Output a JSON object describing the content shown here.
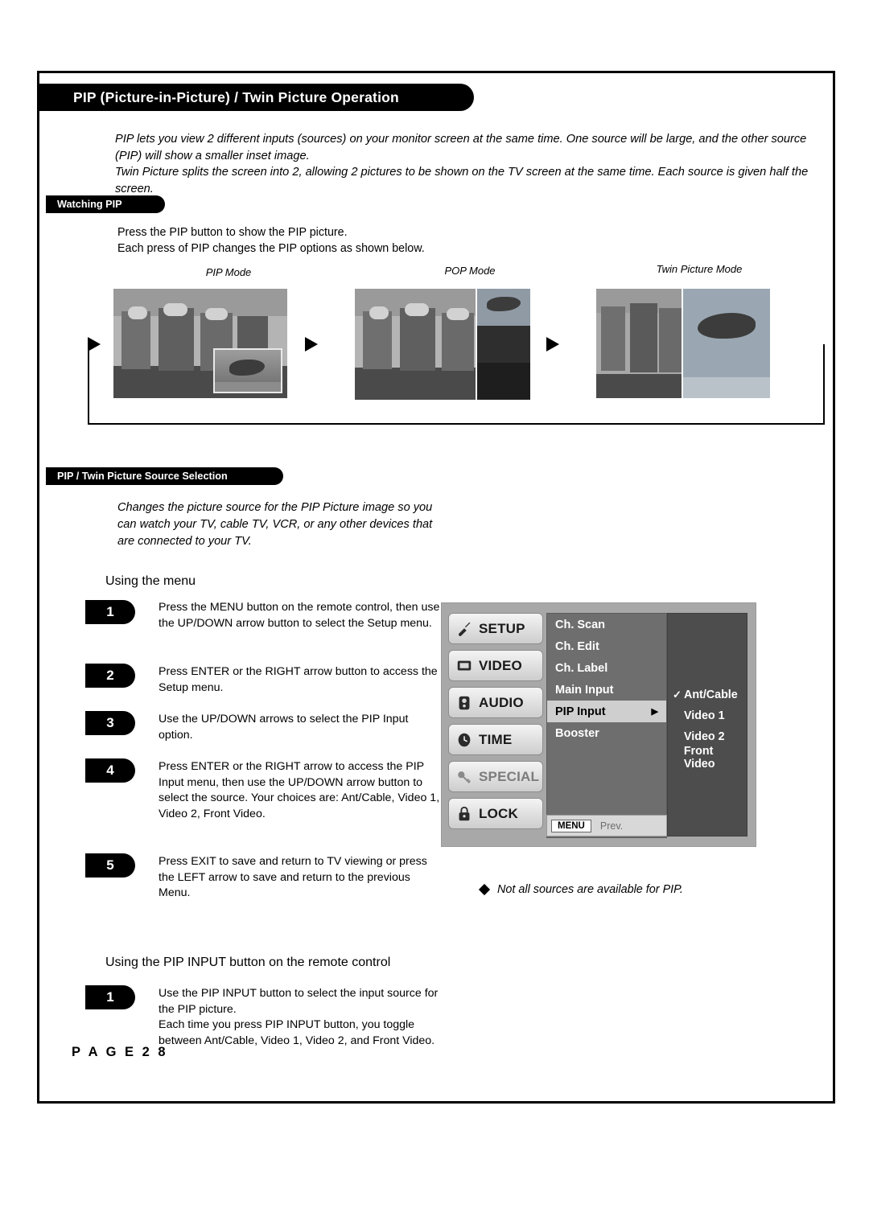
{
  "header": {
    "title": "PIP (Picture-in-Picture) / Twin Picture Operation"
  },
  "intro": {
    "line1": "PIP lets you view 2 different inputs (sources) on your monitor screen at the same time. One source will be large, and the other source (PIP) will show a smaller inset image.",
    "line2": "Twin Picture splits the screen into 2, allowing 2 pictures to be shown on the TV screen at the same time. Each source is given half the screen."
  },
  "watching_pip": {
    "tag": "Watching PIP",
    "line1": "Press the PIP button to show the PIP picture.",
    "line2": "Each press of PIP changes the PIP options as shown below.",
    "modes": [
      "PIP Mode",
      "POP Mode",
      "Twin Picture Mode"
    ]
  },
  "source_selection": {
    "tag": "PIP / Twin Picture Source Selection",
    "description": "Changes the picture source for the PIP Picture image so you can watch your TV, cable TV, VCR, or any other devices that are connected to your TV.",
    "subhead_menu": "Using the menu",
    "subhead_remote": "Using the PIP INPUT button on the remote control",
    "steps": [
      {
        "num": "1",
        "text": "Press the MENU button on the remote control, then use the UP/DOWN arrow button to select the Setup menu."
      },
      {
        "num": "2",
        "text": "Press ENTER or the RIGHT arrow button to access the Setup menu."
      },
      {
        "num": "3",
        "text": "Use the UP/DOWN arrows to select the PIP Input option."
      },
      {
        "num": "4",
        "text": "Press ENTER or the RIGHT arrow to access the PIP Input menu, then use the UP/DOWN arrow button to select the source. Your choices are: Ant/Cable, Video 1, Video 2, Front Video."
      },
      {
        "num": "5",
        "text": "Press EXIT to save and return to TV viewing or press the LEFT arrow to save and return to the previous Menu."
      }
    ],
    "remote_steps": [
      {
        "num": "1",
        "text": "Use the PIP INPUT button to select the input source for the PIP picture.\nEach time you press PIP INPUT button, you toggle between Ant/Cable, Video 1, Video 2, and Front Video."
      }
    ],
    "note": "Not all sources are available for PIP."
  },
  "osd": {
    "menus": [
      {
        "label": "SETUP",
        "icon": "wrench-icon",
        "dim": false
      },
      {
        "label": "VIDEO",
        "icon": "screen-icon",
        "dim": false
      },
      {
        "label": "AUDIO",
        "icon": "speaker-icon",
        "dim": false
      },
      {
        "label": "TIME",
        "icon": "clock-icon",
        "dim": false
      },
      {
        "label": "SPECIAL",
        "icon": "key-icon",
        "dim": true
      },
      {
        "label": "LOCK",
        "icon": "padlock-icon",
        "dim": false
      }
    ],
    "items": [
      {
        "label": "Ch. Scan",
        "selected": false
      },
      {
        "label": "Ch. Edit",
        "selected": false
      },
      {
        "label": "Ch. Label",
        "selected": false
      },
      {
        "label": "Main Input",
        "selected": false
      },
      {
        "label": "PIP Input",
        "selected": true,
        "arrow": "▶"
      },
      {
        "label": "Booster",
        "selected": false
      }
    ],
    "sources": [
      {
        "label": "Ant/Cable",
        "check": "✓"
      },
      {
        "label": "Video 1",
        "check": ""
      },
      {
        "label": "Video 2",
        "check": ""
      },
      {
        "label": "Front Video",
        "check": ""
      }
    ],
    "menu_button": "MENU",
    "prev_label": "Prev."
  },
  "footer": {
    "page": "P A G E   2 8"
  }
}
